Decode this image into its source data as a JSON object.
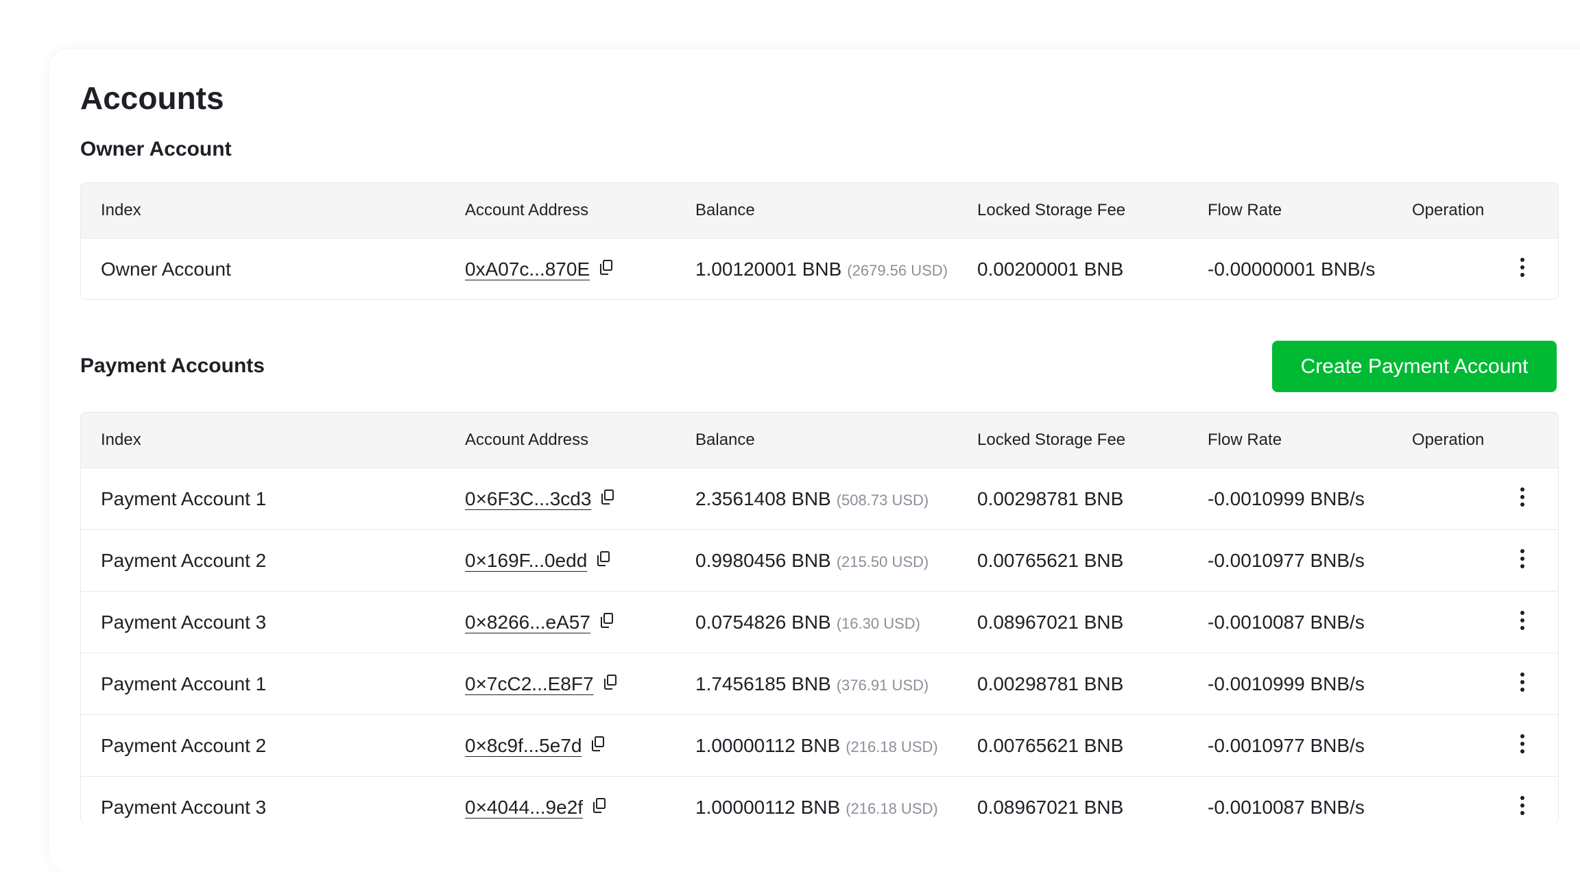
{
  "page": {
    "title": "Accounts"
  },
  "owner": {
    "section_title": "Owner Account",
    "columns": {
      "index": "Index",
      "address": "Account Address",
      "balance": "Balance",
      "fee": "Locked Storage Fee",
      "flow": "Flow Rate",
      "operation": "Operation"
    },
    "row": {
      "index": "Owner Account",
      "address": "0xA07c...870E",
      "balance": "1.00120001 BNB",
      "usd": "(2679.56 USD)",
      "fee": "0.00200001 BNB",
      "flow": "-0.00000001 BNB/s"
    }
  },
  "payment": {
    "section_title": "Payment Accounts",
    "create_button": "Create Payment Account",
    "columns": {
      "index": "Index",
      "address": "Account Address",
      "balance": "Balance",
      "fee": "Locked Storage Fee",
      "flow": "Flow Rate",
      "operation": "Operation"
    },
    "rows": [
      {
        "index": "Payment Account 1",
        "address": "0×6F3C...3cd3",
        "balance": "2.3561408 BNB",
        "usd": "(508.73 USD)",
        "fee": "0.00298781 BNB",
        "flow": "-0.0010999 BNB/s"
      },
      {
        "index": "Payment Account 2",
        "address": "0×169F...0edd",
        "balance": "0.9980456 BNB",
        "usd": "(215.50 USD)",
        "fee": "0.00765621 BNB",
        "flow": "-0.0010977 BNB/s"
      },
      {
        "index": "Payment Account 3",
        "address": "0×8266...eA57",
        "balance": "0.0754826 BNB",
        "usd": "(16.30 USD)",
        "fee": "0.08967021 BNB",
        "flow": "-0.0010087 BNB/s"
      },
      {
        "index": "Payment Account 1",
        "address": "0×7cC2...E8F7",
        "balance": "1.7456185 BNB",
        "usd": "(376.91 USD)",
        "fee": "0.00298781 BNB",
        "flow": "-0.0010999 BNB/s"
      },
      {
        "index": "Payment Account 2",
        "address": "0×8c9f...5e7d",
        "balance": "1.00000112 BNB",
        "usd": "(216.18 USD)",
        "fee": "0.00765621 BNB",
        "flow": "-0.0010977 BNB/s"
      },
      {
        "index": "Payment Account 3",
        "address": "0×4044...9e2f",
        "balance": "1.00000112 BNB",
        "usd": "(216.18 USD)",
        "fee": "0.08967021 BNB",
        "flow": "-0.0010087 BNB/s"
      }
    ]
  },
  "icons": {
    "copy": "copy-icon",
    "more": "more-vertical-icon"
  },
  "colors": {
    "accent": "#00ba34",
    "text": "#1e2026",
    "muted": "#8c8f9b",
    "header_bg": "#f5f5f5",
    "border": "#e6e8ea"
  }
}
